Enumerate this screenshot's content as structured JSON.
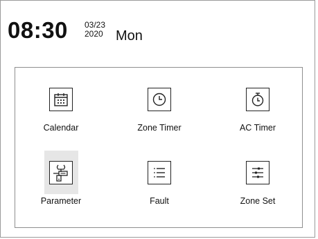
{
  "header": {
    "time": "08:30",
    "date_mmdd": "03/23",
    "year": "2020",
    "weekday": "Mon"
  },
  "menu": {
    "items": [
      {
        "label": "Calendar",
        "icon": "calendar-icon",
        "selected": false
      },
      {
        "label": "Zone Timer",
        "icon": "clock-icon",
        "selected": false
      },
      {
        "label": "AC Timer",
        "icon": "stopwatch-icon",
        "selected": false
      },
      {
        "label": "Parameter",
        "icon": "parameter-tools-icon",
        "selected": true
      },
      {
        "label": "Fault",
        "icon": "list-icon",
        "selected": false
      },
      {
        "label": "Zone Set",
        "icon": "sliders-icon",
        "selected": false
      }
    ]
  },
  "colors": {
    "selected_bg": "#e6e6e6",
    "border": "#8e8e8e",
    "text": "#111111"
  }
}
